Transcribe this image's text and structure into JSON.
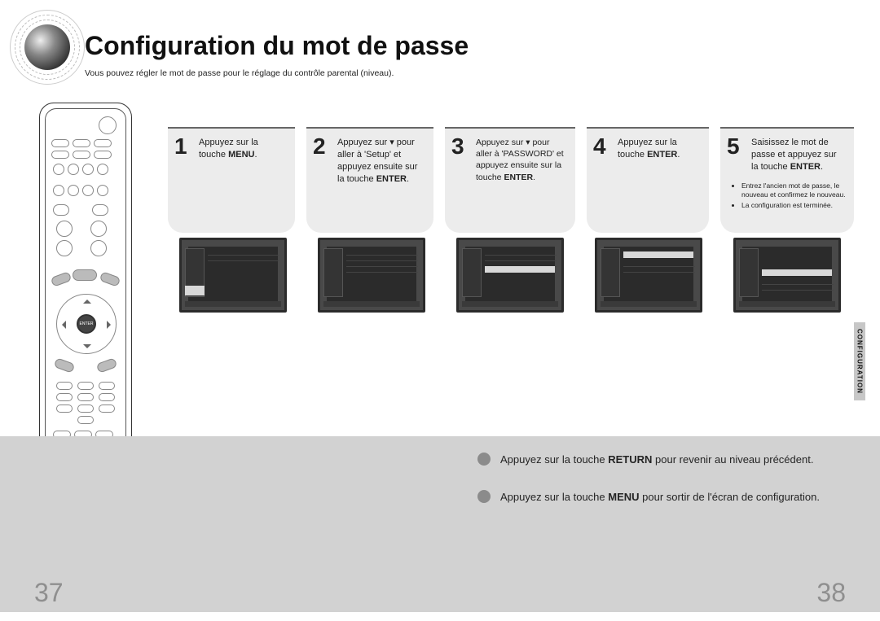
{
  "title": "Configuration du mot de passe",
  "subtitle": "Vous pouvez régler le mot de passe pour le réglage du contrôle parental (niveau).",
  "steps": [
    {
      "num": "1",
      "html": "Appuyez sur la touche <b>MENU</b>."
    },
    {
      "num": "2",
      "html": "Appuyez sur ▾ pour aller à 'Setup' et appuyez ensuite sur la touche <b>ENTER</b>."
    },
    {
      "num": "3",
      "html": "Appuyez sur ▾ pour aller à 'PASSWORD' et appuyez ensuite sur la touche <b>ENTER</b>."
    },
    {
      "num": "4",
      "html": "Appuyez sur la touche <b>ENTER</b>."
    },
    {
      "num": "5",
      "html": "Saisissez le mot de passe et appuyez sur la touche <b>ENTER</b>."
    }
  ],
  "step5_bullets": [
    "Entrez l'ancien mot de passe, le nouveau et confirmez le nouveau.",
    "La configuration est terminée."
  ],
  "side_tab": "CONFIGURATION",
  "notes": [
    "Appuyez sur la touche <b>RETURN</b> pour revenir au niveau précédent.",
    "Appuyez sur la touche <b>MENU</b> pour sortir de l'écran de configuration."
  ],
  "pages": {
    "left": "37",
    "right": "38"
  },
  "remote_center": "ENTER"
}
